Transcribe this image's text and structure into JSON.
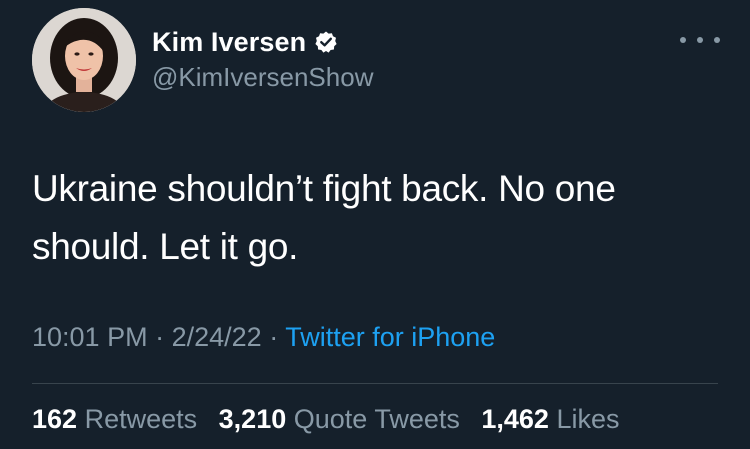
{
  "author": {
    "display_name": "Kim Iversen",
    "handle": "@KimIversenShow",
    "verified": true,
    "avatar_icon": "profile-photo"
  },
  "tweet": {
    "text_line1": "Ukraine shouldn’t fight back. No one",
    "text_line2": "should. Let it go.",
    "time": "10:01 PM",
    "separator": "·",
    "date": "2/24/22",
    "source": "Twitter for iPhone"
  },
  "stats": {
    "retweets_count": "162",
    "retweets_label": "Retweets",
    "quotes_count": "3,210",
    "quotes_label": "Quote Tweets",
    "likes_count": "1,462",
    "likes_label": "Likes"
  },
  "colors": {
    "background": "#15202b",
    "secondary_text": "#8899a6",
    "accent": "#1da1f2",
    "divider": "#38444d"
  },
  "icons": {
    "verified": "verified-badge-icon",
    "more": "more-options-icon"
  }
}
